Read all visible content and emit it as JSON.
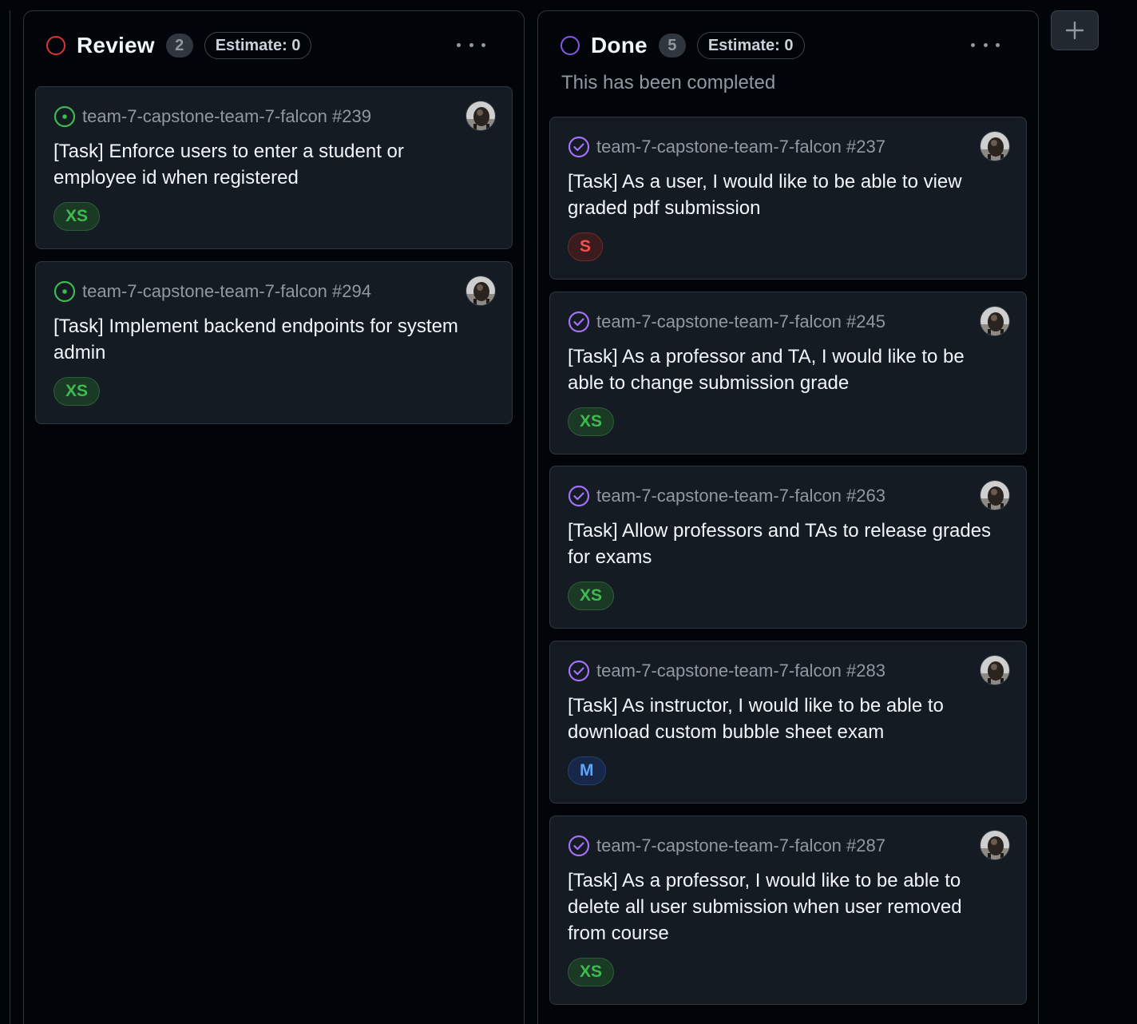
{
  "columns": [
    {
      "title": "Review",
      "count": "2",
      "estimate": "Estimate: 0",
      "status_color": "#da3633",
      "cards": [
        {
          "repo": "team-7-capstone-team-7-falcon #239",
          "title": "[Task] Enforce users to enter a student or employee id when registered",
          "size": "XS",
          "state": "open"
        },
        {
          "repo": "team-7-capstone-team-7-falcon #294",
          "title": "[Task] Implement backend endpoints for system admin",
          "size": "XS",
          "state": "open"
        }
      ]
    },
    {
      "title": "Done",
      "count": "5",
      "estimate": "Estimate: 0",
      "description": "This has been completed",
      "status_color": "#8957e5",
      "cards": [
        {
          "repo": "team-7-capstone-team-7-falcon #237",
          "title": "[Task] As a user, I would like to be able to view graded pdf submission",
          "size": "S",
          "state": "closed"
        },
        {
          "repo": "team-7-capstone-team-7-falcon #245",
          "title": "[Task] As a professor and TA, I would like to be able to change submission grade",
          "size": "XS",
          "state": "closed"
        },
        {
          "repo": "team-7-capstone-team-7-falcon #263",
          "title": "[Task] Allow professors and TAs to release grades for exams",
          "size": "XS",
          "state": "closed"
        },
        {
          "repo": "team-7-capstone-team-7-falcon #283",
          "title": "[Task] As instructor, I would like to be able to download custom bubble sheet exam",
          "size": "M",
          "state": "closed"
        },
        {
          "repo": "team-7-capstone-team-7-falcon #287",
          "title": "[Task] As a professor, I would like to be able to delete all user submission when user removed from course",
          "size": "XS",
          "state": "closed"
        }
      ]
    }
  ],
  "colors": {
    "open_issue": "#3fb950",
    "closed_issue": "#8957e5"
  },
  "icons": {
    "open": "issue-open-icon",
    "closed": "issue-closed-icon",
    "menu": "kebab-menu-icon",
    "add": "plus-icon"
  }
}
